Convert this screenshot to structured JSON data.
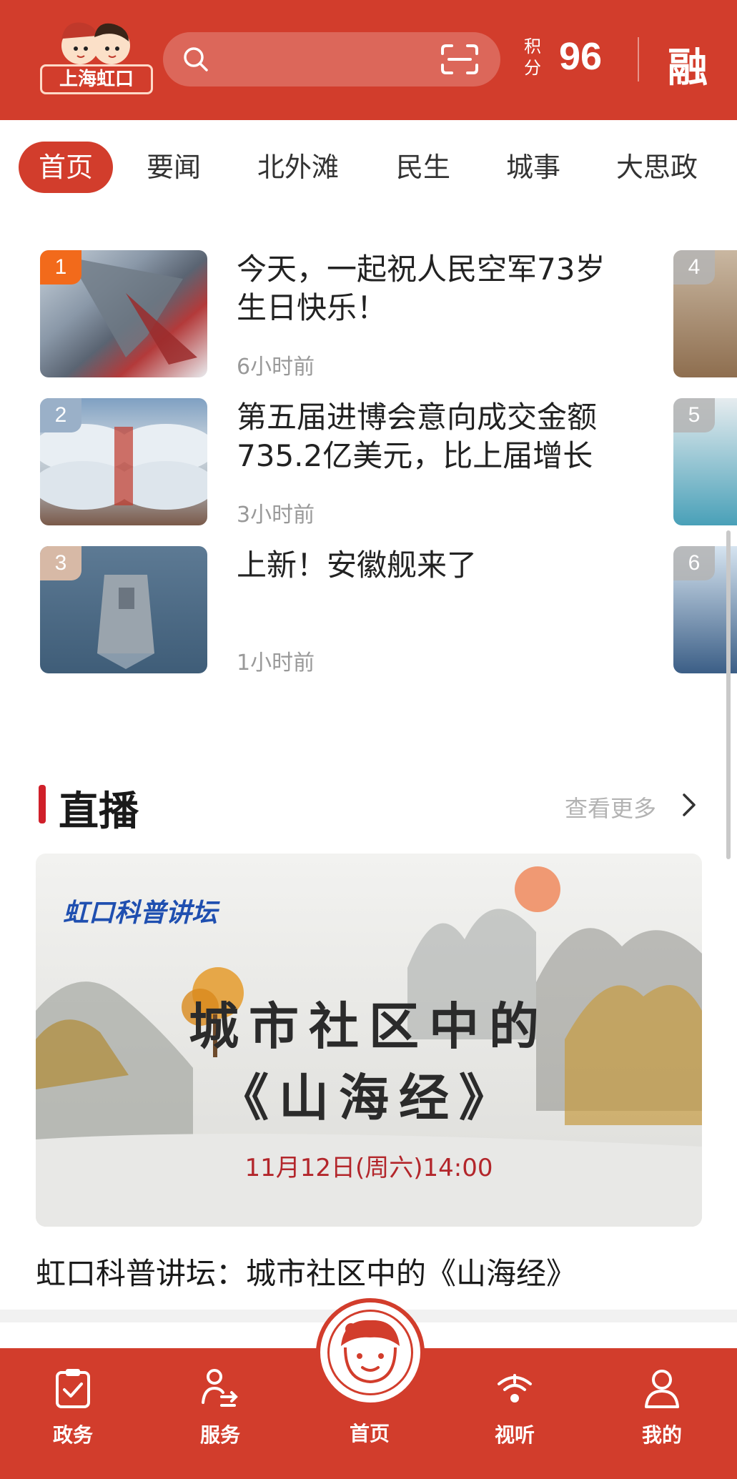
{
  "header": {
    "logo_text": "上海虹口",
    "score_label_top": "积",
    "score_label_bottom": "分",
    "score_value": "96",
    "rong_label": "融"
  },
  "tabs": [
    {
      "label": "首页",
      "active": true
    },
    {
      "label": "要闻"
    },
    {
      "label": "北外滩"
    },
    {
      "label": "民生"
    },
    {
      "label": "城事"
    },
    {
      "label": "大思政"
    }
  ],
  "news": [
    {
      "rank": "1",
      "title": "今天，一起祝人民空军73岁生日快乐！",
      "time": "6小时前",
      "rank_color": "#f26a1b"
    },
    {
      "rank": "2",
      "title": "第五届进博会意向成交金额735.2亿美元，比上届增长",
      "time": "3小时前",
      "rank_color": "#9ab0c8"
    },
    {
      "rank": "3",
      "title": "上新！安徽舰来了",
      "time": "1小时前",
      "rank_color": "#d7b9a6"
    }
  ],
  "peek_items": [
    {
      "rank": "4"
    },
    {
      "rank": "5"
    },
    {
      "rank": "6"
    }
  ],
  "live": {
    "section_title": "直播",
    "more_label": "查看更多",
    "poster_tag": "虹口科普讲坛",
    "poster_line1": "城市社区中的",
    "poster_line2": "《山海经》",
    "poster_date": "11月12日(周六)14:00",
    "caption": "虹口科普讲坛：城市社区中的《山海经》"
  },
  "bottom_nav": [
    {
      "label": "政务",
      "icon": "clipboard-check-icon"
    },
    {
      "label": "服务",
      "icon": "person-service-icon"
    },
    {
      "label": "首页",
      "icon": "mascot-face-icon"
    },
    {
      "label": "视听",
      "icon": "broadcast-icon"
    },
    {
      "label": "我的",
      "icon": "user-icon"
    }
  ],
  "colors": {
    "brand": "#d23d2c",
    "accent_bar": "#d0202a"
  }
}
